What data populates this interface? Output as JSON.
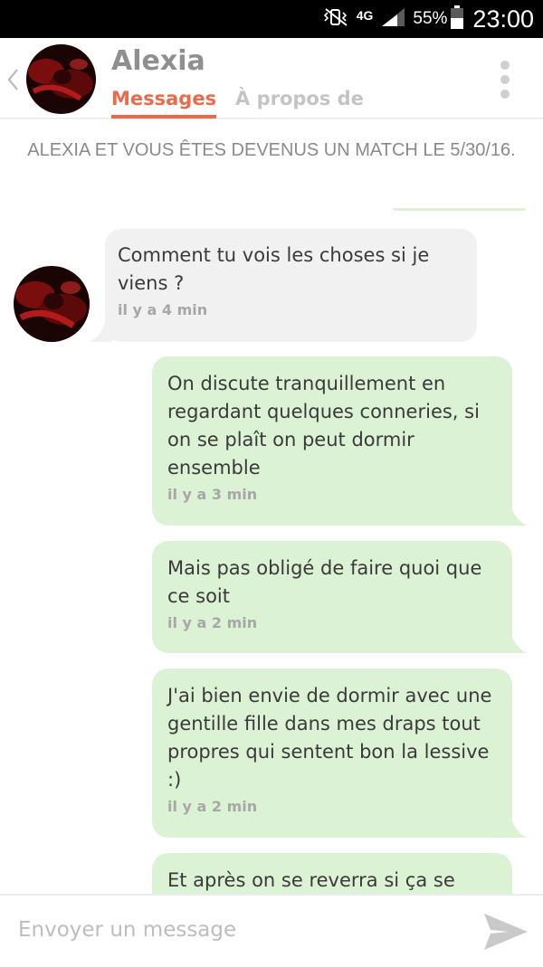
{
  "status_bar": {
    "network": "4G",
    "battery": "55%",
    "time": "23:00",
    "icons": [
      "mute-vibrate-icon",
      "network-4g-icon",
      "signal-icon",
      "battery-icon"
    ]
  },
  "header": {
    "name": "Alexia",
    "tabs": [
      {
        "label": "Messages",
        "active": true
      },
      {
        "label": "À propos de",
        "active": false
      }
    ],
    "accent_color": "#ea6a4a",
    "icons": [
      "back-chevron-icon",
      "more-vert-icon"
    ]
  },
  "conversation": {
    "match_notice": "ALEXIA ET VOUS ÊTES DEVENUS UN MATCH LE 5/30/16.",
    "messages": [
      {
        "direction": "incoming",
        "text": "Comment tu vois les choses si je viens ?",
        "time": "il y a 4 min"
      },
      {
        "direction": "outgoing",
        "text": "On discute tranquillement en regardant quelques conneries, si on se plaît on peut dormir ensemble",
        "time": "il y a 3 min"
      },
      {
        "direction": "outgoing",
        "text": "Mais pas obligé de faire quoi que ce soit",
        "time": "il y a 2 min"
      },
      {
        "direction": "outgoing",
        "text": "J'ai bien envie de dormir avec une gentille fille dans mes draps tout propres qui sentent bon la lessive :)",
        "time": "il y a 2 min"
      },
      {
        "direction": "outgoing",
        "text": "Et après on se reverra si ça se",
        "time": ""
      }
    ],
    "colors": {
      "incoming": "#f1f1f1",
      "outgoing": "#dcf2d4"
    }
  },
  "composer": {
    "placeholder": "Envoyer un message",
    "value": "",
    "icons": [
      "send-icon"
    ]
  }
}
